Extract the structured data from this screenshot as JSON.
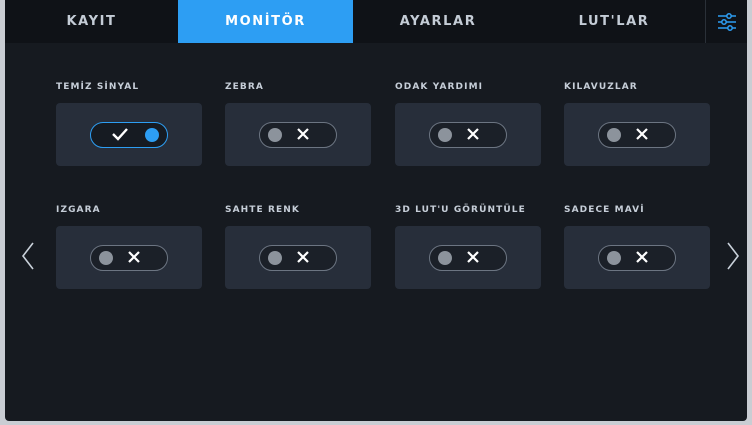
{
  "tabs": [
    {
      "label": "KAYIT",
      "active": false
    },
    {
      "label": "MONİTÖR",
      "active": true
    },
    {
      "label": "AYARLAR",
      "active": false
    },
    {
      "label": "LUT'LAR",
      "active": false
    }
  ],
  "menu_icon": "sliders-icon",
  "settings": [
    {
      "label": "TEMİZ SİNYAL",
      "state": "on"
    },
    {
      "label": "ZEBRA",
      "state": "off"
    },
    {
      "label": "ODAK YARDIMI",
      "state": "off"
    },
    {
      "label": "KILAVUZLAR",
      "state": "off"
    },
    {
      "label": "IZGARA",
      "state": "off"
    },
    {
      "label": "SAHTE RENK",
      "state": "off"
    },
    {
      "label": "3D LUT'U GÖRÜNTÜLE",
      "state": "off"
    },
    {
      "label": "SADECE MAVİ",
      "state": "off"
    }
  ],
  "colors": {
    "accent": "#2d9ef3",
    "background": "#161a20",
    "card": "#272e3a"
  },
  "nav": {
    "prev_icon": "chevron-left-icon",
    "next_icon": "chevron-right-icon"
  }
}
